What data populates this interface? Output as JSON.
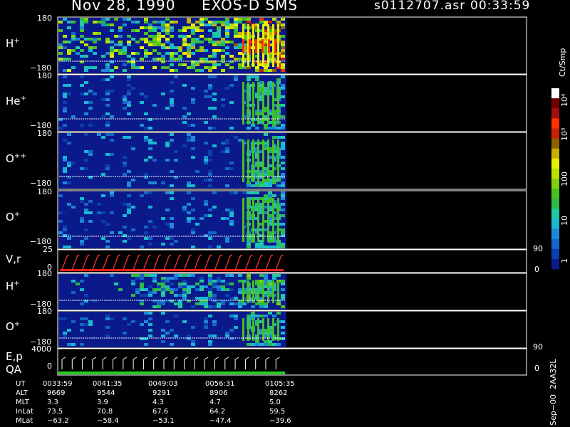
{
  "header": {
    "date": "Nov 28, 1990",
    "instrument": "EXOS-D SMS",
    "file": "s0112707.asr",
    "time": "00:33:59"
  },
  "panels": [
    {
      "id": "h1",
      "label": "H",
      "sup": "+",
      "top": "180",
      "bottom": "−180"
    },
    {
      "id": "he",
      "label": "He",
      "sup": "+",
      "top": "180",
      "bottom": "−180"
    },
    {
      "id": "opp",
      "label": "O",
      "sup": "++",
      "top": "180",
      "bottom": "−180"
    },
    {
      "id": "o1",
      "label": "O",
      "sup": "+",
      "top": "180",
      "bottom": "−180"
    },
    {
      "id": "vr",
      "label": "V,r",
      "sup": "",
      "top": "25",
      "bottom": "0",
      "rtop": "90",
      "rbottom": "0"
    },
    {
      "id": "h2",
      "label": "H",
      "sup": "+",
      "top": "180",
      "bottom": "−180"
    },
    {
      "id": "o2",
      "label": "O",
      "sup": "+",
      "top": "180",
      "bottom": "−180"
    },
    {
      "id": "ep",
      "label": "E,p",
      "sup": "",
      "label2": "QA",
      "top": "4000",
      "bottom": "0",
      "rtop": "90",
      "rbottom": "0"
    }
  ],
  "colorbar": {
    "title": "Ct/Smp",
    "labels": [
      "1",
      "10",
      "100",
      "10³",
      "10⁴"
    ],
    "colors": [
      "#0a1a8a",
      "#0d3fb0",
      "#1565c8",
      "#1e88d8",
      "#18b8d0",
      "#20c8a0",
      "#30b848",
      "#48c020",
      "#80d010",
      "#b8e000",
      "#e8f000",
      "#c8b000",
      "#906000",
      "#c82000",
      "#ff3000",
      "#a01010",
      "#700000",
      "#ffffff"
    ]
  },
  "annotations": {
    "labels": [
      "UT",
      "ALT",
      "MLT",
      "InLat",
      "MLat"
    ],
    "columns": [
      [
        "0033:59",
        "9669",
        "3.3",
        "73.5",
        "−63.2"
      ],
      [
        "0041:35",
        "9544",
        "3.9",
        "70.8",
        "−58.4"
      ],
      [
        "0049:03",
        "9291",
        "4.3",
        "67.6",
        "−53.1"
      ],
      [
        "0056:31",
        "8906",
        "4.7",
        "64.2",
        "−47.4"
      ],
      [
        "0105:35",
        "8262",
        "5.0",
        "59.5",
        "−39.6"
      ]
    ],
    "footer": "Sep−00  2AA32L"
  },
  "chart_data": {
    "type": "heatmap",
    "x": [
      "0033:59",
      "0041:35",
      "0049:03",
      "0056:31",
      "0105:35"
    ],
    "series": [
      {
        "name": "H+",
        "ylim": [
          -180,
          180
        ]
      },
      {
        "name": "He+",
        "ylim": [
          -180,
          180
        ]
      },
      {
        "name": "O++",
        "ylim": [
          -180,
          180
        ]
      },
      {
        "name": "O+",
        "ylim": [
          -180,
          180
        ]
      },
      {
        "name": "V,r",
        "ylim": [
          0,
          25
        ],
        "y2lim": [
          0,
          90
        ]
      },
      {
        "name": "H+",
        "ylim": [
          -180,
          180
        ]
      },
      {
        "name": "O+",
        "ylim": [
          -180,
          180
        ]
      },
      {
        "name": "E,p",
        "ylim": [
          0,
          4000
        ],
        "y2lim": [
          0,
          90
        ]
      }
    ]
  }
}
